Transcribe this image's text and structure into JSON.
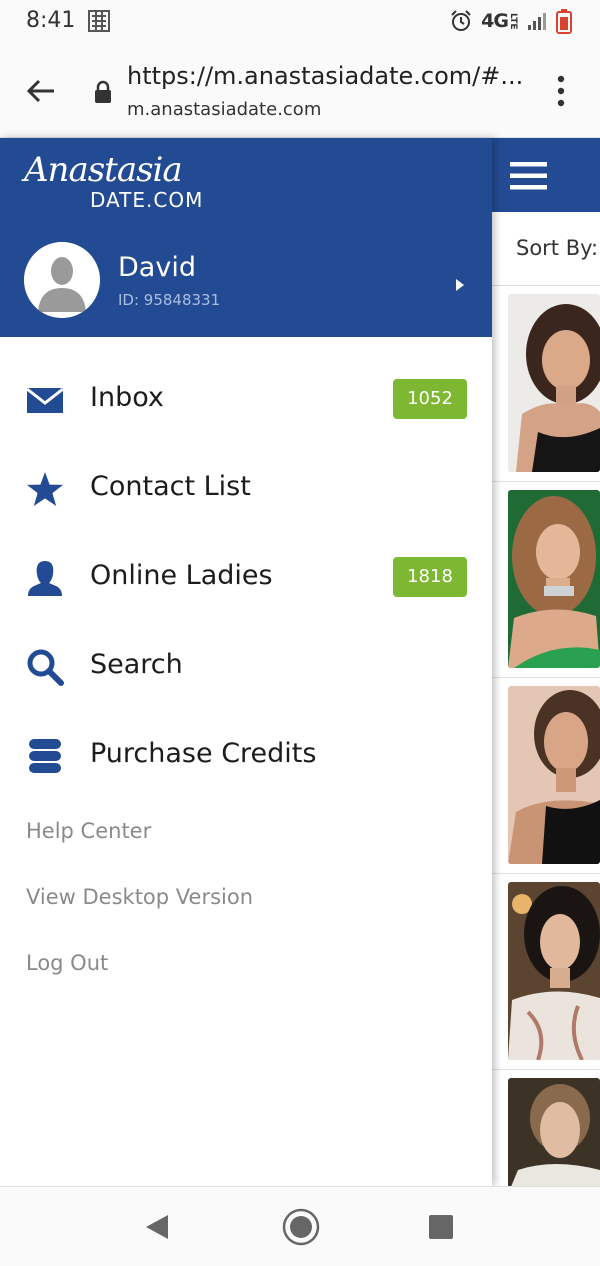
{
  "status_bar": {
    "time": "8:41",
    "network": "4G",
    "network_sub": "LTE"
  },
  "browser": {
    "url": "https://m.anastasiadate.com/#...",
    "domain": "m.anastasiadate.com"
  },
  "drawer": {
    "logo_script": "Anastasia",
    "logo_suffix": "DATE.COM",
    "profile": {
      "name": "David",
      "id": "ID: 95848331"
    },
    "menu": [
      {
        "label": "Inbox",
        "icon": "envelope-icon",
        "badge": "1052"
      },
      {
        "label": "Contact List",
        "icon": "star-icon"
      },
      {
        "label": "Online Ladies",
        "icon": "person-icon",
        "badge": "1818"
      },
      {
        "label": "Search",
        "icon": "search-icon"
      },
      {
        "label": "Purchase Credits",
        "icon": "database-icon"
      }
    ],
    "secondary_links": [
      "Help Center",
      "View Desktop Version",
      "Log Out"
    ]
  },
  "main": {
    "sort_label": "Sort By:"
  },
  "colors": {
    "brand_blue": "#234b93",
    "badge_green": "#7eb833"
  }
}
